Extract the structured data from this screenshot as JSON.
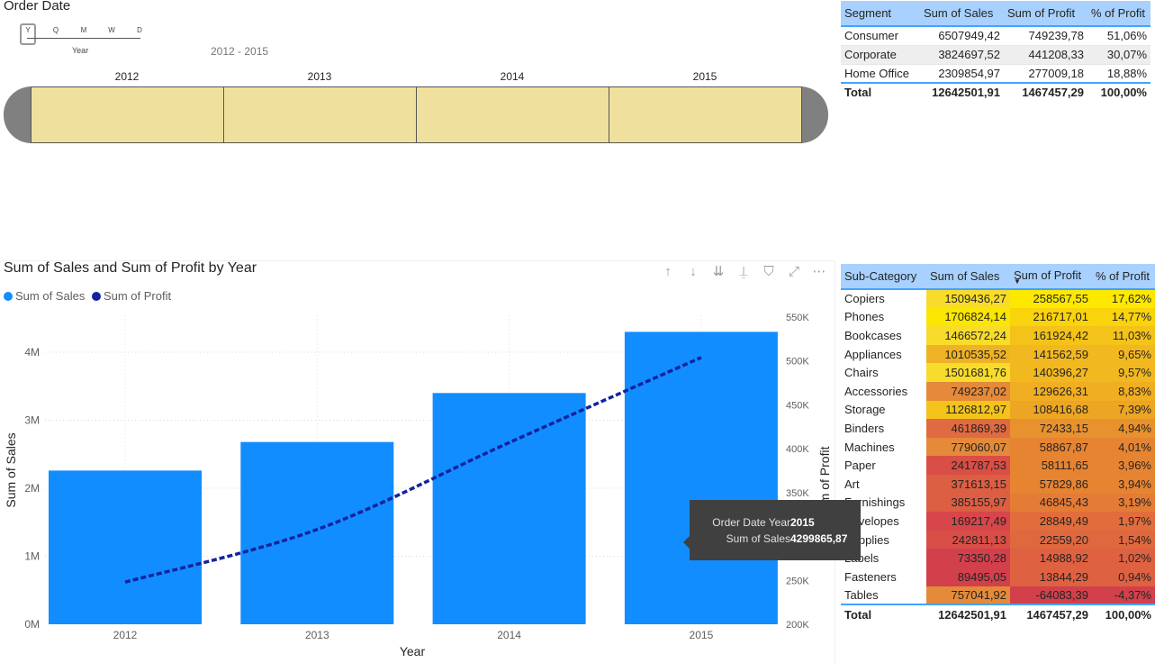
{
  "slicer": {
    "title": "Order Date",
    "granularity": [
      "Y",
      "Q",
      "M",
      "W",
      "D"
    ],
    "granularity_caption": "Year",
    "range_label": "2012 - 2015",
    "years": [
      "2012",
      "2013",
      "2014",
      "2015"
    ]
  },
  "segment_table": {
    "headers": [
      "Segment",
      "Sum of Sales",
      "Sum of Profit",
      "% of Profit"
    ],
    "rows": [
      [
        "Consumer",
        "6507949,42",
        "749239,78",
        "51,06%"
      ],
      [
        "Corporate",
        "3824697,52",
        "441208,33",
        "30,07%"
      ],
      [
        "Home Office",
        "2309854,97",
        "277009,18",
        "18,88%"
      ]
    ],
    "total": [
      "Total",
      "12642501,91",
      "1467457,29",
      "100,00%"
    ]
  },
  "subcategory_table": {
    "headers": [
      "Sub-Category",
      "Sum of Sales",
      "Sum of Profit",
      "% of Profit"
    ],
    "rows": [
      [
        "Copiers",
        "1509436,27",
        "258567,55",
        "17,62%"
      ],
      [
        "Phones",
        "1706824,14",
        "216717,01",
        "14,77%"
      ],
      [
        "Bookcases",
        "1466572,24",
        "161924,42",
        "11,03%"
      ],
      [
        "Appliances",
        "1010535,52",
        "141562,59",
        "9,65%"
      ],
      [
        "Chairs",
        "1501681,76",
        "140396,27",
        "9,57%"
      ],
      [
        "Accessories",
        "749237,02",
        "129626,31",
        "8,83%"
      ],
      [
        "Storage",
        "1126812,97",
        "108416,68",
        "7,39%"
      ],
      [
        "Binders",
        "461869,39",
        "72433,15",
        "4,94%"
      ],
      [
        "Machines",
        "779060,07",
        "58867,87",
        "4,01%"
      ],
      [
        "Paper",
        "241787,53",
        "58111,65",
        "3,96%"
      ],
      [
        "Art",
        "371613,15",
        "57829,86",
        "3,94%"
      ],
      [
        "Furnishings",
        "385155,97",
        "46845,43",
        "3,19%"
      ],
      [
        "Envelopes",
        "169217,49",
        "28849,49",
        "1,97%"
      ],
      [
        "Supplies",
        "242811,13",
        "22559,20",
        "1,54%"
      ],
      [
        "Labels",
        "73350,28",
        "14988,92",
        "1,02%"
      ],
      [
        "Fasteners",
        "89495,05",
        "13844,29",
        "0,94%"
      ],
      [
        "Tables",
        "757041,92",
        "-64083,39",
        "-4,37%"
      ]
    ],
    "cell_colors": [
      [
        "#f8dc2b",
        "#fde800",
        "#fde800"
      ],
      [
        "#fae600",
        "#f9d30c",
        "#f9d30c"
      ],
      [
        "#f8dc2b",
        "#f4c31a",
        "#f4c31a"
      ],
      [
        "#efb225",
        "#f2b81f",
        "#f2b81f"
      ],
      [
        "#f8dc2b",
        "#f2b81f",
        "#f2b81f"
      ],
      [
        "#e48a3a",
        "#f0ae22",
        "#f0ae22"
      ],
      [
        "#f4c31a",
        "#eda524",
        "#eda524"
      ],
      [
        "#e06a41",
        "#e8922e",
        "#e8922e"
      ],
      [
        "#e48a3a",
        "#e68432",
        "#e68432"
      ],
      [
        "#d94e46",
        "#e68432",
        "#e68432"
      ],
      [
        "#dc5e43",
        "#e68432",
        "#e68432"
      ],
      [
        "#dc5e43",
        "#e47c35",
        "#e47c35"
      ],
      [
        "#d6464a",
        "#e16d3d",
        "#e16d3d"
      ],
      [
        "#d94e46",
        "#e0683f",
        "#e0683f"
      ],
      [
        "#d2404c",
        "#de6141",
        "#de6141"
      ],
      [
        "#d2404c",
        "#de6141",
        "#de6141"
      ],
      [
        "#e48a3a",
        "#d2404c",
        "#d2404c"
      ]
    ],
    "total": [
      "Total",
      "12642501,91",
      "1467457,29",
      "100,00%"
    ]
  },
  "chart": {
    "title": "Sum of Sales and Sum of Profit by Year",
    "legend": [
      "Sum of Sales",
      "Sum of Profit"
    ],
    "toolbar_icons": [
      "arrow-up-icon",
      "arrow-down-icon",
      "double-arrow-down-icon",
      "hierarchy-icon",
      "filter-icon",
      "focus-mode-icon",
      "more-options-icon"
    ]
  },
  "chart_data": {
    "type": "bar",
    "title": "Sum of Sales and Sum of Profit by Year",
    "xlabel": "Year",
    "ylabel": "Sum of Sales",
    "y2label": "Sum of Profit",
    "categories": [
      "2012",
      "2013",
      "2014",
      "2015"
    ],
    "series": [
      {
        "name": "Sum of Sales",
        "type": "bar",
        "axis": "left",
        "color": "#118dff",
        "values": [
          2260000,
          2680000,
          3400000,
          4299865.87
        ]
      },
      {
        "name": "Sum of Profit",
        "type": "line",
        "axis": "right",
        "color": "#12239e",
        "dashed": true,
        "values": [
          248000,
          308000,
          407000,
          504000
        ]
      }
    ],
    "ylim": [
      0,
      4000000
    ],
    "y_ticks": [
      0,
      1000000,
      2000000,
      3000000,
      4000000
    ],
    "y_tick_labels": [
      "0M",
      "1M",
      "2M",
      "3M",
      "4M"
    ],
    "y2lim": [
      200000,
      550000
    ],
    "y2_ticks": [
      200000,
      250000,
      300000,
      350000,
      400000,
      450000,
      500000,
      550000
    ],
    "y2_tick_labels": [
      "200K",
      "250K",
      "300K",
      "350K",
      "400K",
      "450K",
      "500K",
      "550K"
    ],
    "grid": true,
    "legend_position": "top-left"
  },
  "tooltip": {
    "rows": [
      {
        "key": "Order Date Year",
        "value": "2015"
      },
      {
        "key": "Sum of Sales",
        "value": "4299865,87"
      }
    ]
  }
}
